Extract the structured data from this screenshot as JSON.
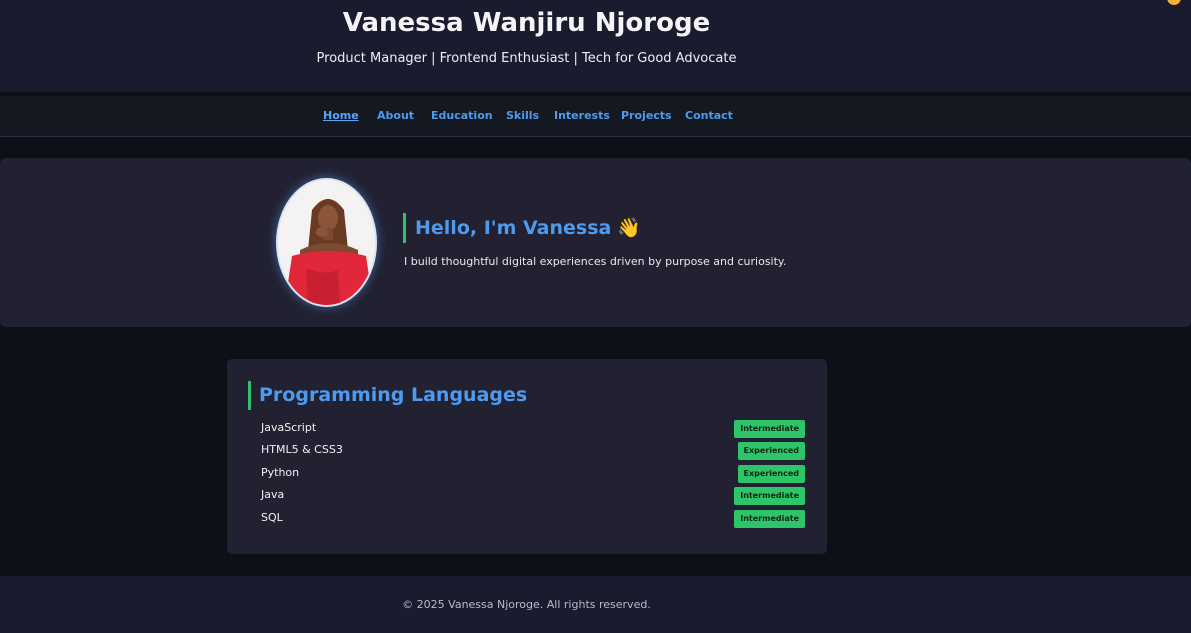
{
  "header": {
    "title": "Vanessa Wanjiru Njoroge",
    "tagline": "Product Manager | Frontend Enthusiast | Tech for Good Advocate"
  },
  "nav": {
    "items": [
      {
        "label": "Home",
        "active": true
      },
      {
        "label": "About"
      },
      {
        "label": "Education"
      },
      {
        "label": "Skills"
      },
      {
        "label": "Interests"
      },
      {
        "label": "Projects"
      },
      {
        "label": "Contact"
      }
    ]
  },
  "hero": {
    "heading": "Hello, I'm Vanessa",
    "wave": "👋",
    "text": "I build thoughtful digital experiences driven by purpose and curiosity."
  },
  "skills": {
    "title": "Programming Languages",
    "items": [
      {
        "name": "JavaScript",
        "level": "Intermediate"
      },
      {
        "name": "HTML5 & CSS3",
        "level": "Experienced"
      },
      {
        "name": "Python",
        "level": "Experienced"
      },
      {
        "name": "Java",
        "level": "Intermediate"
      },
      {
        "name": "SQL",
        "level": "Intermediate"
      }
    ]
  },
  "footer": {
    "text": "© 2025 Vanessa Njoroge. All rights reserved."
  },
  "colors": {
    "accent": "#4e9aef",
    "badge": "#2ec46a",
    "header_bg": "#1b1b2f",
    "card_bg": "#222132",
    "page_bg": "#0d1017"
  }
}
